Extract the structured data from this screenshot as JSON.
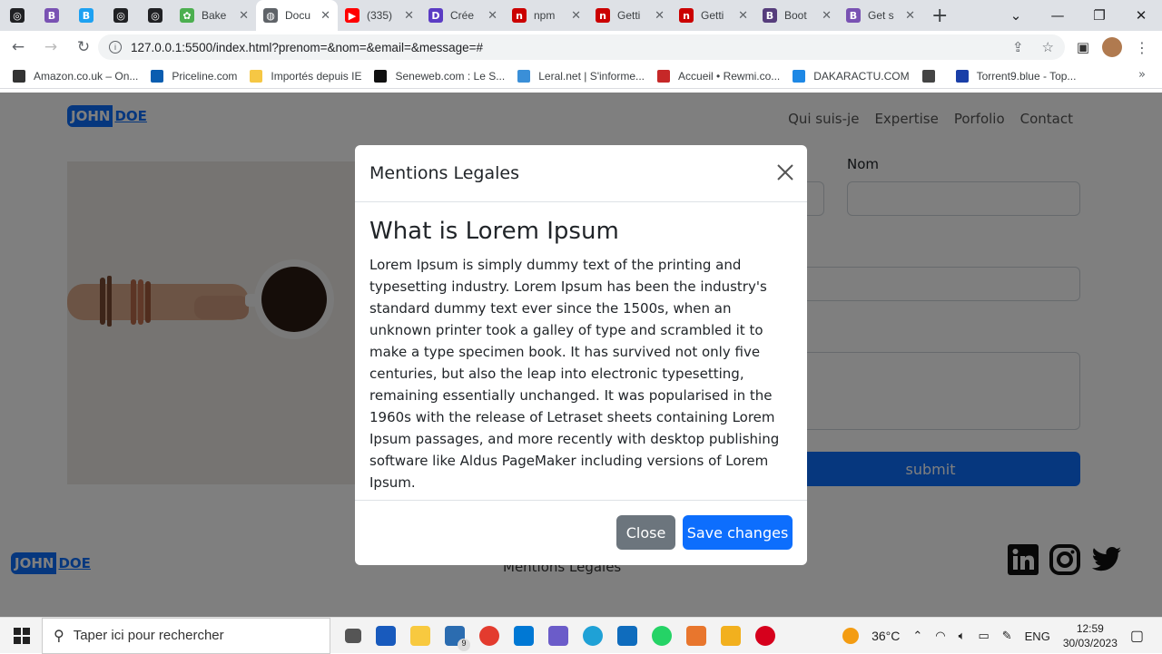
{
  "browser": {
    "tabs": [
      {
        "label": "",
        "color": "#202124",
        "glyph": "◎"
      },
      {
        "label": "",
        "color": "#7952b3",
        "glyph": "B"
      },
      {
        "label": "",
        "color": "#1da1f2",
        "glyph": "B"
      },
      {
        "label": "",
        "color": "#202124",
        "glyph": "◎"
      },
      {
        "label": "",
        "color": "#202124",
        "glyph": "◎"
      },
      {
        "label": "Bake",
        "color": "#4caf50",
        "glyph": "✿"
      },
      {
        "label": "Docu",
        "color": "#5f6368",
        "glyph": "◍"
      },
      {
        "label": "(335)",
        "color": "#ff0000",
        "glyph": "▶"
      },
      {
        "label": "Crée",
        "color": "#5b3cc4",
        "glyph": "D"
      },
      {
        "label": "npm",
        "color": "#cb0000",
        "glyph": "n"
      },
      {
        "label": "Getti",
        "color": "#cb0000",
        "glyph": "n"
      },
      {
        "label": "Getti",
        "color": "#cb0000",
        "glyph": "n"
      },
      {
        "label": "Boot",
        "color": "#563d7c",
        "glyph": "B"
      },
      {
        "label": "Get s",
        "color": "#7952b3",
        "glyph": "B"
      }
    ],
    "url": "127.0.0.1:5500/index.html?prenom=&nom=&email=&message=#",
    "bookmarks": [
      {
        "label": "Amazon.co.uk – On...",
        "color": "#333"
      },
      {
        "label": "Priceline.com",
        "color": "#0a5db0"
      },
      {
        "label": "Importés depuis IE",
        "color": "#f6c744"
      },
      {
        "label": "Seneweb.com : Le S...",
        "color": "#111"
      },
      {
        "label": "Leral.net | S'informe...",
        "color": "#3a8fd8"
      },
      {
        "label": "Accueil • Rewmi.co...",
        "color": "#c62828"
      },
      {
        "label": "DAKARACTU.COM",
        "color": "#1e88e5"
      },
      {
        "label": "",
        "color": "#444"
      },
      {
        "label": "Torrent9.blue - Top...",
        "color": "#1a3fa8"
      }
    ]
  },
  "site": {
    "logo_first": "JOHN",
    "logo_last": "DOE",
    "nav": [
      "Qui suis-je",
      "Expertise",
      "Porfolio",
      "Contact"
    ],
    "form": {
      "nom_label": "Nom",
      "submit_label": "submit"
    },
    "footer_link": "Mentions Legales"
  },
  "modal": {
    "title": "Mentions Legales",
    "heading": "What is Lorem Ipsum",
    "body": "Lorem Ipsum is simply dummy text of the printing and typesetting industry. Lorem Ipsum has been the industry's standard dummy text ever since the 1500s, when an unknown printer took a galley of type and scrambled it to make a type specimen book. It has survived not only five centuries, but also the leap into electronic typesetting, remaining essentially unchanged. It was popularised in the 1960s with the release of Letraset sheets containing Lorem Ipsum passages, and more recently with desktop publishing software like Aldus PageMaker including versions of Lorem Ipsum.",
    "close_label": "Close",
    "save_label": "Save changes"
  },
  "taskbar": {
    "search_placeholder": "Taper ici pour rechercher",
    "mail_badge": "9",
    "temperature": "36°C",
    "lang": "ENG",
    "time": "12:59",
    "date": "30/03/2023"
  }
}
